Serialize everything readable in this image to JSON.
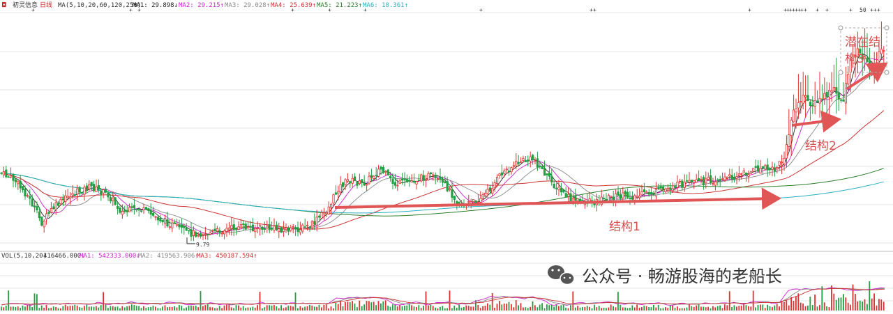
{
  "header": {
    "stock_name": "初灵信息",
    "period": "日线",
    "ma_params": "MA(5,10,20,60,120,250)",
    "ma_items": [
      {
        "label": "MA1: 29.898↓",
        "color": "#222222"
      },
      {
        "label": "MA2: 29.215↑",
        "color": "#cc22cc"
      },
      {
        "label": "MA3: 29.028↑",
        "color": "#888888"
      },
      {
        "label": "MA4: 25.639↑",
        "color": "#cc3333"
      },
      {
        "label": "MA5: 21.223↑",
        "color": "#2a7d2a"
      },
      {
        "label": "MA6: 18.361↑",
        "color": "#2ab0c0"
      }
    ]
  },
  "volume_header": {
    "params": "VOL(5,10,20)",
    "value": "416466.000↓",
    "items": [
      {
        "label": "MA1: 542333.000↓",
        "color": "#cc22cc"
      },
      {
        "label": "MA2: 419563.906↑",
        "color": "#888888"
      },
      {
        "label": "MA3: 450187.594↑",
        "color": "#cc3333"
      }
    ]
  },
  "annotations": {
    "low_label": "9.79",
    "top_marker": "50",
    "structure1": "结构1",
    "structure2": "结构2",
    "structure3": "潜在结构3"
  },
  "watermark": "公众号 · 畅游股海的老船长",
  "colors": {
    "up": "#e03030",
    "down": "#20a040",
    "arrow": "#e05555",
    "grid": "#e6e6e6"
  },
  "chart_data": {
    "type": "candlestick",
    "title": "初灵信息 日线",
    "low_point": 9.79,
    "series": [
      {
        "name": "MA1",
        "last": 29.898
      },
      {
        "name": "MA2",
        "last": 29.215
      },
      {
        "name": "MA3",
        "last": 29.028
      },
      {
        "name": "MA4",
        "last": 25.639
      },
      {
        "name": "MA5",
        "last": 21.223
      },
      {
        "name": "MA6",
        "last": 18.361
      }
    ],
    "volume": {
      "last": 416466.0,
      "ma": [
        {
          "name": "MA1",
          "last": 542333.0
        },
        {
          "name": "MA2",
          "last": 419563.906
        },
        {
          "name": "MA3",
          "last": 450187.594
        }
      ]
    },
    "grid": true
  }
}
